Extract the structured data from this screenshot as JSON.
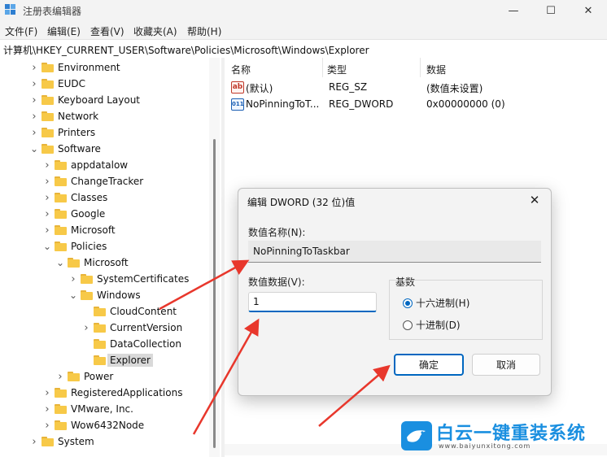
{
  "window": {
    "title": "注册表编辑器",
    "minimize": "—",
    "maximize": "☐",
    "close": "✕"
  },
  "menu": [
    "文件(F)",
    "编辑(E)",
    "查看(V)",
    "收藏夹(A)",
    "帮助(H)"
  ],
  "address": "计算机\\HKEY_CURRENT_USER\\Software\\Policies\\Microsoft\\Windows\\Explorer",
  "tree": [
    {
      "label": "Environment",
      "level": 0,
      "expanded": false,
      "selected": false
    },
    {
      "label": "EUDC",
      "level": 0,
      "expanded": false,
      "selected": false
    },
    {
      "label": "Keyboard Layout",
      "level": 0,
      "expanded": false,
      "selected": false
    },
    {
      "label": "Network",
      "level": 0,
      "expanded": false,
      "selected": false
    },
    {
      "label": "Printers",
      "level": 0,
      "expanded": false,
      "selected": false
    },
    {
      "label": "Software",
      "level": 0,
      "expanded": true,
      "selected": false
    },
    {
      "label": "appdatalow",
      "level": 1,
      "expanded": false,
      "selected": false
    },
    {
      "label": "ChangeTracker",
      "level": 1,
      "expanded": false,
      "selected": false
    },
    {
      "label": "Classes",
      "level": 1,
      "expanded": false,
      "selected": false
    },
    {
      "label": "Google",
      "level": 1,
      "expanded": false,
      "selected": false
    },
    {
      "label": "Microsoft",
      "level": 1,
      "expanded": false,
      "selected": false
    },
    {
      "label": "Policies",
      "level": 1,
      "expanded": true,
      "selected": false
    },
    {
      "label": "Microsoft",
      "level": 2,
      "expanded": true,
      "selected": false
    },
    {
      "label": "SystemCertificates",
      "level": 3,
      "expanded": false,
      "selected": false
    },
    {
      "label": "Windows",
      "level": 3,
      "expanded": true,
      "selected": false
    },
    {
      "label": "CloudContent",
      "level": 4,
      "expanded": null,
      "selected": false
    },
    {
      "label": "CurrentVersion",
      "level": 4,
      "expanded": false,
      "selected": false
    },
    {
      "label": "DataCollection",
      "level": 4,
      "expanded": null,
      "selected": false
    },
    {
      "label": "Explorer",
      "level": 4,
      "expanded": null,
      "selected": true
    },
    {
      "label": "Power",
      "level": 2,
      "expanded": false,
      "selected": false
    },
    {
      "label": "RegisteredApplications",
      "level": 1,
      "expanded": false,
      "selected": false
    },
    {
      "label": "VMware, Inc.",
      "level": 1,
      "expanded": false,
      "selected": false
    },
    {
      "label": "Wow6432Node",
      "level": 1,
      "expanded": false,
      "selected": false
    },
    {
      "label": "System",
      "level": 0,
      "expanded": false,
      "selected": false
    }
  ],
  "list": {
    "headers": [
      "名称",
      "类型",
      "数据"
    ],
    "rows": [
      {
        "name": "(默认)",
        "type": "REG_SZ",
        "data": "(数值未设置)",
        "icon": "string-value-icon"
      },
      {
        "name": "NoPinningToT...",
        "type": "REG_DWORD",
        "data": "0x00000000 (0)",
        "icon": "dword-value-icon"
      }
    ]
  },
  "dialog": {
    "title": "编辑 DWORD (32 位)值",
    "name_label": "数值名称(N):",
    "name_value": "NoPinningToTaskbar",
    "data_label": "数值数据(V):",
    "data_value": "1",
    "base_label": "基数",
    "hex_label": "十六进制(H)",
    "dec_label": "十进制(D)",
    "hex_selected": true,
    "ok_label": "确定",
    "cancel_label": "取消"
  },
  "watermark": {
    "name": "白云一键重装系统",
    "url": "www.baiyunxitong.com"
  },
  "colors": {
    "accent": "#0067c0",
    "arrow": "#e8372c",
    "watermark": "#1a8fe0"
  }
}
